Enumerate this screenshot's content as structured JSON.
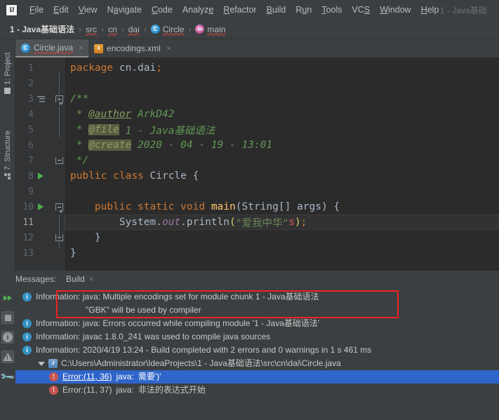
{
  "window": {
    "title": "1 - Java基础"
  },
  "menubar": {
    "logo": "IJ",
    "items": [
      {
        "label": "File",
        "mnemonic_index": 0
      },
      {
        "label": "Edit",
        "mnemonic_index": 0
      },
      {
        "label": "View",
        "mnemonic_index": 0
      },
      {
        "label": "Navigate",
        "mnemonic_index": 1
      },
      {
        "label": "Code",
        "mnemonic_index": 0
      },
      {
        "label": "Analyze",
        "mnemonic_index": 6
      },
      {
        "label": "Refactor",
        "mnemonic_index": 0
      },
      {
        "label": "Build",
        "mnemonic_index": 0
      },
      {
        "label": "Run",
        "mnemonic_index": 1
      },
      {
        "label": "Tools",
        "mnemonic_index": 0
      },
      {
        "label": "VCS",
        "mnemonic_index": 2
      },
      {
        "label": "Window",
        "mnemonic_index": 0
      },
      {
        "label": "Help",
        "mnemonic_index": 0
      }
    ]
  },
  "breadcrumb": {
    "items": [
      {
        "label": "1 - Java基础语法",
        "icon": "none",
        "wavy": false,
        "bold": true
      },
      {
        "label": "src",
        "icon": "none",
        "wavy": true,
        "bold": false
      },
      {
        "label": "cn",
        "icon": "none",
        "wavy": true,
        "bold": false
      },
      {
        "label": "dai",
        "icon": "none",
        "wavy": true,
        "bold": false
      },
      {
        "label": "Circle",
        "icon": "class-icon",
        "wavy": true,
        "bold": false
      },
      {
        "label": "main",
        "icon": "method-icon",
        "wavy": true,
        "bold": false
      }
    ],
    "separator": "›"
  },
  "left_tool_strip": {
    "tabs": [
      {
        "label": "1: Project",
        "icon": "folder-icon"
      },
      {
        "label": "7: Structure",
        "icon": "structure-icon"
      }
    ]
  },
  "editor": {
    "tabs": [
      {
        "label": "Circle.java",
        "icon": "java-class-icon",
        "active": true,
        "wavy": true,
        "close": "×"
      },
      {
        "label": "encodings.xml",
        "icon": "xml-file-icon",
        "active": false,
        "wavy": false,
        "close": "×"
      }
    ],
    "current_line": 11,
    "lines": [
      {
        "num": "1",
        "run": false
      },
      {
        "num": "2",
        "run": false
      },
      {
        "num": "3",
        "run": false
      },
      {
        "num": "4",
        "run": false
      },
      {
        "num": "5",
        "run": false
      },
      {
        "num": "6",
        "run": false
      },
      {
        "num": "7",
        "run": false
      },
      {
        "num": "8",
        "run": true
      },
      {
        "num": "9",
        "run": false
      },
      {
        "num": "10",
        "run": true
      },
      {
        "num": "11",
        "run": false
      },
      {
        "num": "12",
        "run": false
      },
      {
        "num": "13",
        "run": false
      }
    ],
    "code": {
      "l1_package": "package",
      "l1_name": "cn.dai",
      "l1_semi": ";",
      "l3": "/**",
      "l4_star": " * ",
      "l4_tag": "@author",
      "l4_val": " ArkD42",
      "l5_star": " * ",
      "l5_tag": "@file",
      "l5_val": " 1 - Java基础语法",
      "l6_star": " * ",
      "l6_tag": "@create",
      "l6_val": " 2020 - 04 - 19 - 13:01",
      "l7": " */",
      "l8_pub": "public",
      "l8_class": "class",
      "l8_name": "Circle",
      "l8_brace": "{",
      "l10_pub": "public",
      "l10_static": "static",
      "l10_void": "void",
      "l10_main": "main",
      "l10_args": "(String[] args) {",
      "l11_sys": "System.",
      "l11_out": "out",
      "l11_dot": ".",
      "l11_println": "println",
      "l11_lparen": "(",
      "l11_str": "\"爱我中华\"",
      "l11_err": "s",
      "l11_rparen": ")",
      "l11_semi": ";",
      "l12_brace": "}",
      "l13_brace": "}"
    }
  },
  "messages_panel": {
    "label": "Messages:",
    "tab": "Build",
    "tab_close": "×",
    "toolbar": [
      {
        "name": "rerun-icon"
      },
      {
        "name": "stop-icon"
      },
      {
        "name": "info-filter-icon"
      },
      {
        "name": "warning-filter-icon"
      },
      {
        "name": "settings-wrench-icon"
      }
    ],
    "highlight_color": "#ee2222",
    "rows": [
      {
        "type": "info",
        "text": "Information: java: Multiple encodings set for module chunk 1 - Java基础语法",
        "continuation": "\"GBK\" will be used by compiler",
        "highlighted": true
      },
      {
        "type": "info",
        "text": "Information: java: Errors occurred while compiling module '1 - Java基础语法'",
        "highlighted": false
      },
      {
        "type": "info",
        "text": "Information: javac 1.8.0_241 was used to compile java sources",
        "highlighted": false
      },
      {
        "type": "info",
        "text": "Information: 2020/4/19 13:24 - Build completed with 2 errors and 0 warnings in 1 s 461 ms",
        "highlighted": false
      }
    ],
    "file_node": {
      "path": "C:\\Users\\Administrator\\IdeaProjects\\1 - Java基础语法\\src\\cn\\dai\\Circle.java",
      "expanded": true
    },
    "errors": [
      {
        "location": "Error:(11, 36)",
        "prefix": "java:",
        "message": "需要')'",
        "selected": true
      },
      {
        "location": "Error:(11, 37)",
        "prefix": "java:",
        "message": "非法的表达式开始",
        "selected": false
      }
    ]
  }
}
